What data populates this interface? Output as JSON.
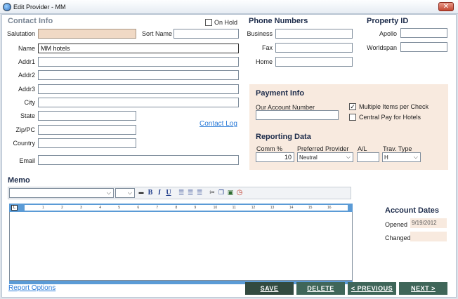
{
  "window": {
    "title": "Edit Provider - MM",
    "close_glyph": "✕"
  },
  "contact": {
    "heading": "Contact Info",
    "on_hold_label": "On Hold",
    "salutation_label": "Salutation",
    "salutation_value": "",
    "sort_name_label": "Sort Name",
    "sort_name_value": "",
    "name_label": "Name",
    "name_value": "MM hotels",
    "addr1_label": "Addr1",
    "addr2_label": "Addr2",
    "addr3_label": "Addr3",
    "city_label": "City",
    "state_label": "State",
    "zip_label": "Zip/PC",
    "country_label": "Country",
    "email_label": "Email",
    "contact_log_link": "Contact Log"
  },
  "phones": {
    "heading": "Phone Numbers",
    "business_label": "Business",
    "fax_label": "Fax",
    "home_label": "Home"
  },
  "property_id": {
    "heading": "Property ID",
    "apollo_label": "Apollo",
    "worldspan_label": "Worldspan"
  },
  "payment": {
    "heading": "Payment Info",
    "account_number_label": "Our Account Number",
    "account_number_value": "",
    "multiple_items_label": "Multiple Items per Check",
    "multiple_items_checked": true,
    "central_pay_label": "Central Pay for Hotels",
    "central_pay_checked": false
  },
  "reporting": {
    "heading": "Reporting Data",
    "comm_label": "Comm %",
    "comm_value": "10",
    "preferred_label": "Preferred Provider",
    "preferred_value": "Neutral",
    "al_label": "A/L",
    "al_value": "",
    "trav_type_label": "Trav. Type",
    "trav_type_value": "H"
  },
  "memo": {
    "heading": "Memo",
    "font_value": "",
    "size_value": "",
    "bold": "B",
    "italic": "I",
    "underline": "U",
    "ruler_marks": [
      "1",
      "2",
      "3",
      "4",
      "5",
      "6",
      "7",
      "8",
      "9",
      "10",
      "11",
      "12",
      "13",
      "14",
      "15",
      "16"
    ],
    "ruler_corner": "L"
  },
  "account_dates": {
    "heading": "Account Dates",
    "opened_label": "Opened",
    "opened_value": "9/19/2012",
    "changed_label": "Changed",
    "changed_value": ""
  },
  "footer": {
    "report_options_link": "Report Options",
    "save_label": "SAVE",
    "delete_label": "DELETE",
    "previous_label": "< PREVIOUS",
    "next_label": "NEXT >"
  },
  "colors": {
    "accent_link": "#2b7bd8",
    "panel_bg": "#f8eadf",
    "save_btn": "#324a40",
    "nav_btn": "#3f6659",
    "ruler": "#5b9bd6"
  }
}
